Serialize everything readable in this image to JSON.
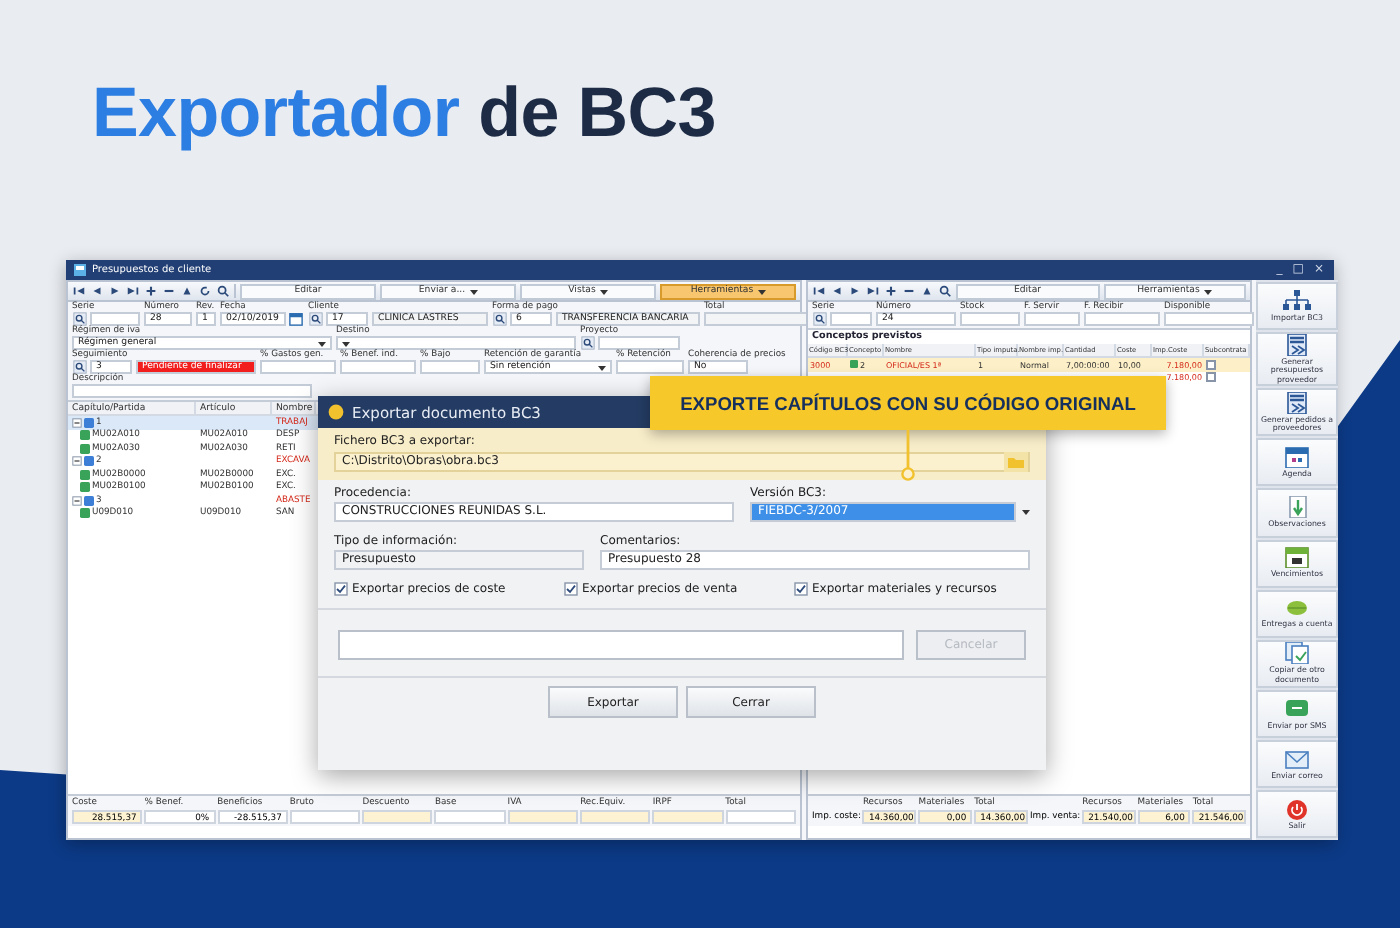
{
  "heading": {
    "parts": [
      {
        "text": "Exportador",
        "accent": true
      },
      {
        "text": "de BC3",
        "accent": false
      }
    ]
  },
  "window": {
    "title": "Presupuestos de cliente",
    "controls": [
      "_",
      "□",
      "×"
    ]
  },
  "toolbar": {
    "buttons": [
      {
        "label": "Editar",
        "dropdown": false,
        "selected": false
      },
      {
        "label": "Enviar a...",
        "dropdown": true,
        "selected": false
      },
      {
        "label": "Vistas",
        "dropdown": true,
        "selected": false
      },
      {
        "label": "Herramientas",
        "dropdown": true,
        "selected": true
      }
    ]
  },
  "form": {
    "sections": [
      [
        {
          "label": "Serie",
          "kind": "lookup"
        },
        {
          "label": "Número",
          "value": "28",
          "kind": "text"
        },
        {
          "label": "Rev.",
          "value": "1",
          "kind": "text"
        },
        {
          "label": "Fecha",
          "value": "02/10/2019",
          "kind": "date"
        },
        {
          "label": "Cliente",
          "value": "17",
          "kind": "lookup"
        },
        {
          "value": "CLINICA LASTRES",
          "kind": "readonly"
        },
        {
          "label": "Forma de pago",
          "value": "6",
          "kind": "lookup"
        },
        {
          "value": "TRANSFERENCIA BANCARIA",
          "kind": "readonly"
        },
        {
          "label": "Total",
          "kind": "readonly"
        }
      ],
      [
        {
          "label": "Régimen de iva",
          "value": "Régimen general",
          "kind": "select"
        },
        {
          "label": "Destino",
          "kind": "select"
        },
        {
          "label": "Proyecto",
          "kind": "lookup"
        }
      ],
      [
        {
          "label": "Seguimiento",
          "value": "3",
          "kind": "lookup"
        },
        {
          "value": "Pendiente de finalizar",
          "kind": "status"
        },
        {
          "label": "% Gastos gen.",
          "kind": "text"
        },
        {
          "label": "% Benef. ind.",
          "kind": "text"
        },
        {
          "label": "% Bajo",
          "kind": "text"
        },
        {
          "label": "Retención de garantía",
          "value": "Sin retención",
          "kind": "select"
        },
        {
          "label": "% Retención",
          "kind": "text"
        },
        {
          "label": "Coherencia de precios",
          "value": "No",
          "kind": "text"
        }
      ],
      [
        {
          "label": "Descripción",
          "kind": "text"
        }
      ]
    ]
  },
  "tree": {
    "columns": [
      "Capítulo/Partida",
      "Artículo",
      "Nombre"
    ],
    "rows": [
      {
        "code": "1",
        "name": "TRABAJ",
        "kind": "chapter",
        "expanded": true,
        "selected": true,
        "children": [
          {
            "code": "MU02A010",
            "article": "MU02A010",
            "name": "DESP",
            "kind": "item",
            "selected": false
          },
          {
            "code": "MU02A030",
            "article": "MU02A030",
            "name": "RETI",
            "kind": "item",
            "selected": false
          }
        ]
      },
      {
        "code": "2",
        "name": "EXCAVA",
        "kind": "chapter",
        "expanded": true,
        "selected": false,
        "children": [
          {
            "code": "MU02B0000",
            "article": "MU02B0000",
            "name": "EXC.",
            "kind": "item",
            "selected": false
          },
          {
            "code": "MU02B0100",
            "article": "MU02B0100",
            "name": "EXC.",
            "kind": "item",
            "selected": false
          }
        ]
      },
      {
        "code": "3",
        "name": "ABASTE",
        "kind": "chapter",
        "expanded": true,
        "selected": false,
        "children": [
          {
            "code": "U09D010",
            "article": "U09D010",
            "name": "SAN",
            "kind": "item",
            "selected": false
          }
        ]
      }
    ]
  },
  "summary": [
    {
      "label": "Coste",
      "value": "28.515,37",
      "kind": "calc"
    },
    {
      "label": "% Benef.",
      "value": "0%",
      "kind": "input"
    },
    {
      "label": "Beneficios",
      "value": "-28.515,37",
      "kind": "input"
    },
    {
      "label": "Bruto",
      "kind": "input"
    },
    {
      "label": "Descuento",
      "kind": "calc"
    },
    {
      "label": "Base",
      "kind": "input"
    },
    {
      "label": "IVA",
      "kind": "calc"
    },
    {
      "label": "Rec.Equiv.",
      "kind": "calc"
    },
    {
      "label": "IRPF",
      "kind": "calc"
    },
    {
      "label": "Total",
      "kind": "input"
    }
  ],
  "resources": {
    "toolbar": [
      {
        "label": "Editar",
        "dropdown": false
      },
      {
        "label": "Herramientas",
        "dropdown": true
      }
    ],
    "fields": [
      {
        "label": "Serie",
        "kind": "lookup"
      },
      {
        "label": "Número",
        "value": "24",
        "kind": "text"
      },
      {
        "label": "Stock",
        "kind": "text"
      },
      {
        "label": "F. Servir",
        "kind": "text"
      },
      {
        "label": "F. Recibir",
        "kind": "text"
      },
      {
        "label": "Disponible",
        "kind": "text"
      }
    ],
    "title": "Conceptos previstos",
    "columns": [
      "Código BC3",
      "Concepto",
      "Nombre",
      "Tipo imputa.",
      "Nombre imp.",
      "Cantidad",
      "Coste",
      "Imp.Coste",
      "Subcontrata"
    ],
    "rows": [
      {
        "code": "3000",
        "concept": "2",
        "name": "OFICIAL/ES 1ª",
        "type": "1",
        "imp_name": "Normal",
        "qty": "7,00:00:00",
        "cost": "10,00",
        "imp_cost": "7.180,00",
        "subcontract": false,
        "selected": true
      },
      {
        "imp_cost": "7.180,00",
        "subcontract": false,
        "selected": false
      }
    ],
    "totals": [
      {
        "label": "Imp. coste:",
        "columns": [
          "Recursos",
          "Materiales",
          "Total"
        ],
        "values": [
          "14.360,00",
          "0,00",
          "14.360,00"
        ]
      },
      {
        "label": "Imp. venta:",
        "columns": [
          "Recursos",
          "Materiales",
          "Total"
        ],
        "values": [
          "21.540,00",
          "6,00",
          "21.546,00"
        ]
      }
    ]
  },
  "actions": [
    {
      "label": "Importar BC3",
      "kind": "hierarchy"
    },
    {
      "label": "Generar presupuestos proveedor",
      "kind": "stack"
    },
    {
      "label": "Generar pedidos a proveedores",
      "kind": "stack"
    },
    {
      "label": "Agenda",
      "kind": "calendar"
    },
    {
      "label": "Observaciones",
      "kind": "note"
    },
    {
      "label": "Vencimientos",
      "kind": "due"
    },
    {
      "label": "Entregas a cuenta",
      "kind": "coin"
    },
    {
      "label": "Copiar de otro documento",
      "kind": "copy"
    },
    {
      "label": "Enviar por SMS",
      "kind": "chat"
    },
    {
      "label": "Enviar correo",
      "kind": "mail"
    },
    {
      "label": "Salir",
      "kind": "power"
    }
  ],
  "dialog": {
    "title": "Exportar documento BC3",
    "file": {
      "label": "Fichero BC3 a exportar:",
      "value": "C:\\Distrito\\Obras\\obra.bc3"
    },
    "origin": {
      "label": "Procedencia:",
      "value": "CONSTRUCCIONES REUNIDAS S.L."
    },
    "version": {
      "label": "Versión BC3:",
      "value": "FIEBDC-3/2007"
    },
    "info_type": {
      "label": "Tipo de información:",
      "value": "Presupuesto"
    },
    "comments": {
      "label": "Comentarios:",
      "value": "Presupuesto 28"
    },
    "options": [
      {
        "label": "Exportar precios de coste",
        "checked": true
      },
      {
        "label": "Exportar precios de venta",
        "checked": true
      },
      {
        "label": "Exportar materiales y recursos",
        "checked": true
      }
    ],
    "progress": {
      "level": 0
    },
    "cancel": {
      "label": "Cancelar",
      "disabled": true
    },
    "buttons": [
      "Exportar",
      "Cerrar"
    ]
  },
  "callout": {
    "text": "EXPORTE CAPÍTULOS CON SU CÓDIGO ORIGINAL"
  }
}
